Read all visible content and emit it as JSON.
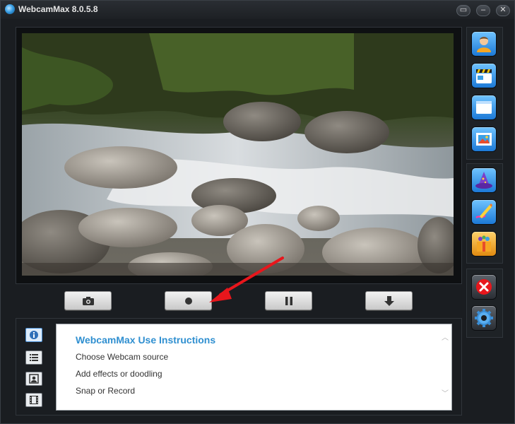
{
  "window": {
    "title": "WebcamMax  8.0.5.8",
    "buttons": {
      "restore": "▭",
      "minimize": "–",
      "close": "✕"
    }
  },
  "video": {
    "description_icon": "river-video-frame"
  },
  "controls": [
    {
      "name": "snapshot-button",
      "icon": "camera-icon"
    },
    {
      "name": "record-button",
      "icon": "record-icon"
    },
    {
      "name": "pause-button",
      "icon": "pause-icon"
    },
    {
      "name": "download-button",
      "icon": "download-icon"
    }
  ],
  "side": {
    "group1": [
      "person-icon",
      "clapper-icon",
      "window-icon",
      "picture-icon"
    ],
    "group2": [
      "wizard-hat-icon",
      "pencil-icon",
      "gift-box-icon"
    ],
    "group3": [
      "close-x-icon",
      "settings-gear-icon"
    ]
  },
  "info": {
    "title": "WebcamMax Use Instructions",
    "lines": [
      "Choose Webcam source",
      "Add effects or doodling",
      "Snap or Record"
    ],
    "tabs": [
      "info-icon",
      "list-icon",
      "portrait-icon",
      "film-icon"
    ]
  },
  "colors": {
    "accent": "#2f8fd0",
    "annotation_arrow": "#e8161c"
  }
}
